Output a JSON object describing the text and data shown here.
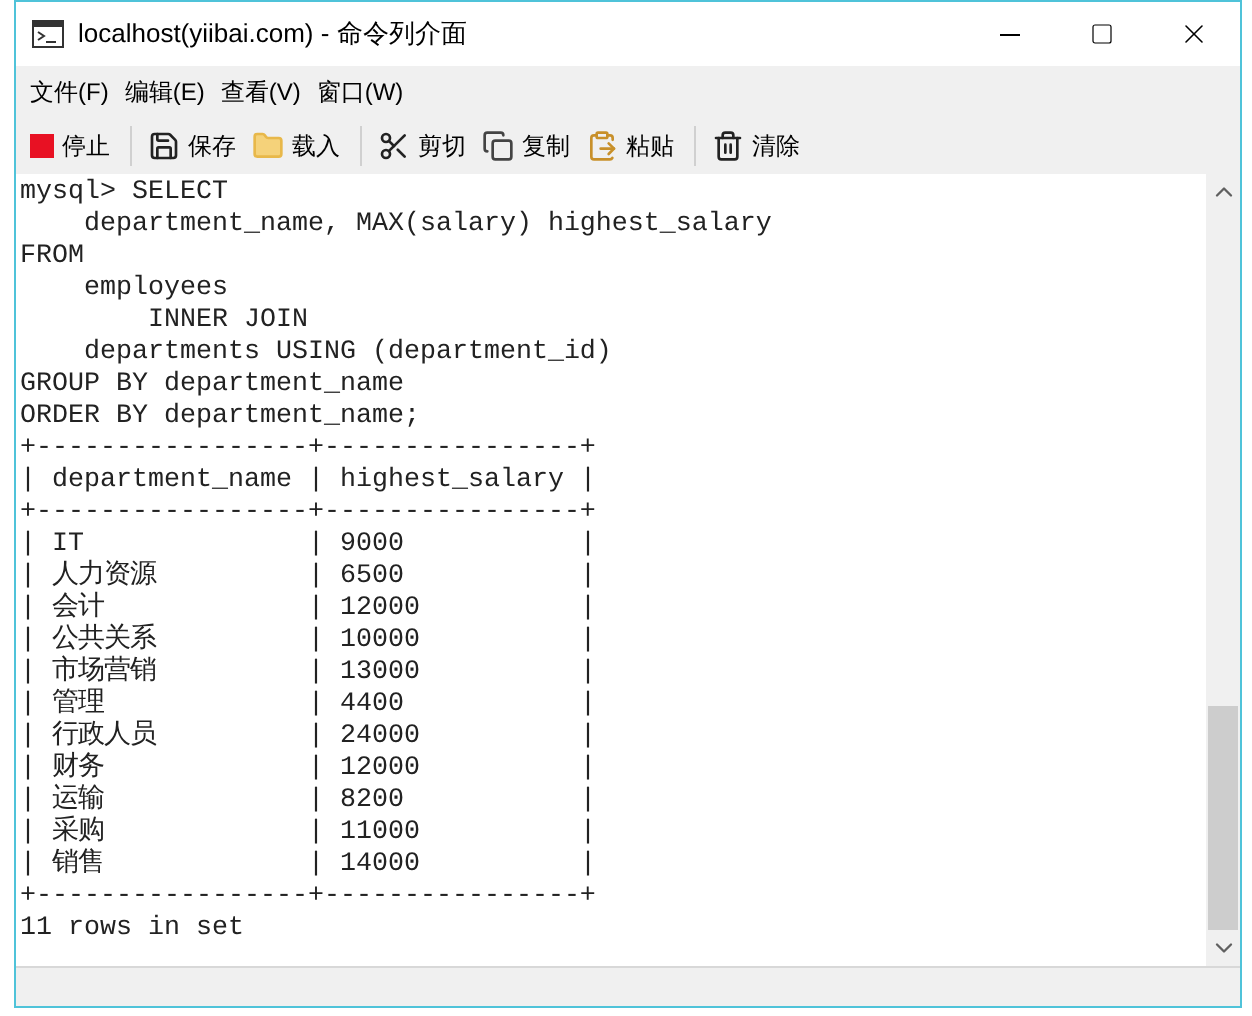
{
  "window": {
    "title": "localhost(yiibai.com) - 命令列介面"
  },
  "menu": [
    "文件(F)",
    "编辑(E)",
    "查看(V)",
    "窗口(W)"
  ],
  "toolbar": [
    {
      "kind": "stop",
      "label": "停止"
    },
    {
      "kind": "separator"
    },
    {
      "kind": "save",
      "label": "保存"
    },
    {
      "kind": "load",
      "label": "载入"
    },
    {
      "kind": "separator"
    },
    {
      "kind": "cut",
      "label": "剪切"
    },
    {
      "kind": "copy",
      "label": "复制"
    },
    {
      "kind": "paste",
      "label": "粘贴"
    },
    {
      "kind": "separator"
    },
    {
      "kind": "clear",
      "label": "清除"
    }
  ],
  "console": {
    "query_lines": [
      "mysql> SELECT",
      "    department_name, MAX(salary) highest_salary",
      "FROM",
      "    employees",
      "        INNER JOIN",
      "    departments USING (department_id)",
      "GROUP BY department_name",
      "ORDER BY department_name;"
    ],
    "border": "+-----------------+----------------+",
    "separator": "|",
    "columns": [
      "department_name",
      "highest_salary"
    ],
    "rows": [
      [
        "IT",
        "9000"
      ],
      [
        "人力资源",
        "6500"
      ],
      [
        "会计",
        "12000"
      ],
      [
        "公共关系",
        "10000"
      ],
      [
        "市场营销",
        "13000"
      ],
      [
        "管理",
        "4400"
      ],
      [
        "行政人员",
        "24000"
      ],
      [
        "财务",
        "12000"
      ],
      [
        "运输",
        "8200"
      ],
      [
        "采购",
        "11000"
      ],
      [
        "销售",
        "14000"
      ]
    ],
    "result": "11 rows in set"
  }
}
